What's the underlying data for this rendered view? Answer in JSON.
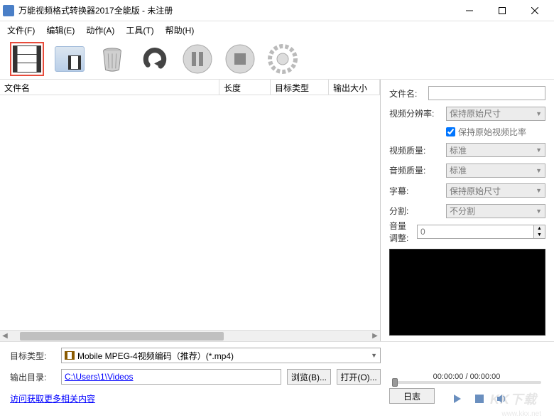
{
  "window": {
    "title": "万能视频格式转换器2017全能版 - 未注册"
  },
  "menu": {
    "file": "文件(F)",
    "edit": "编辑(E)",
    "action": "动作(A)",
    "tools": "工具(T)",
    "help": "帮助(H)"
  },
  "columns": {
    "filename": "文件名",
    "length": "长度",
    "target_type": "目标类型",
    "output_size": "输出大小"
  },
  "settings": {
    "filename_label": "文件名:",
    "filename_value": "",
    "resolution_label": "视频分辨率:",
    "resolution_value": "保持原始尺寸",
    "keep_bitrate_checked": true,
    "keep_bitrate_label": "保持原始视频比率",
    "video_quality_label": "视频质量:",
    "video_quality_value": "标准",
    "audio_quality_label": "音频质量:",
    "audio_quality_value": "标准",
    "subtitle_label": "字幕:",
    "subtitle_value": "保持原始尺寸",
    "split_label": "分割:",
    "split_value": "不分割",
    "volume_label": "音量调整:",
    "volume_value": "0"
  },
  "preview": {
    "time_display": "00:00:00 / 00:00:00"
  },
  "bottom": {
    "target_type_label": "目标类型:",
    "target_type_value": "Mobile MPEG-4视频编码（推荐）(*.mp4)",
    "output_dir_label": "输出目录:",
    "output_dir_value": "C:\\Users\\1\\Videos",
    "browse_btn": "浏览(B)...",
    "open_btn": "打开(O)...",
    "more_link": "访问获取更多相关内容",
    "log_btn": "日志"
  },
  "watermark": {
    "main": "KK下载",
    "sub": "www.kkx.net"
  }
}
